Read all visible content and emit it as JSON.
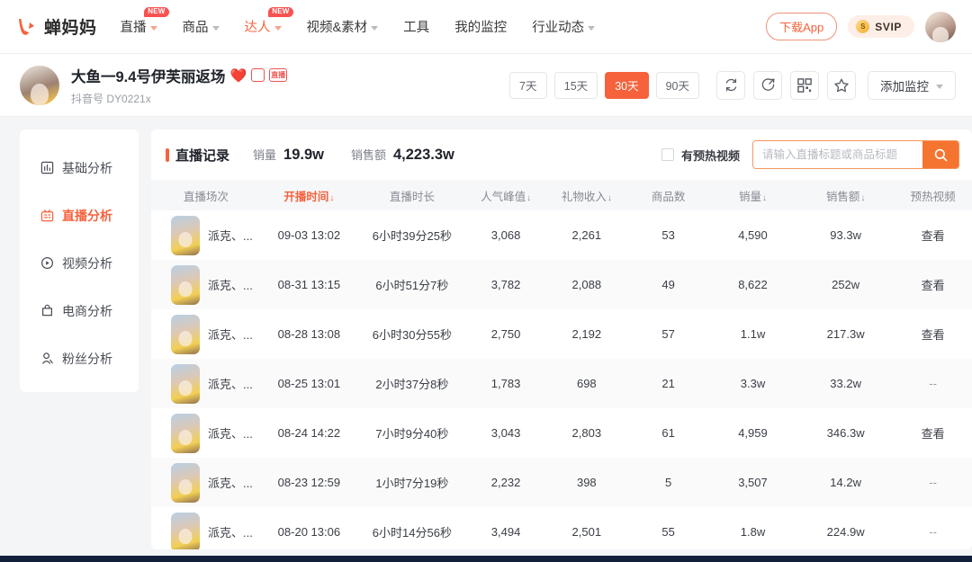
{
  "topbar": {
    "logo_text": "蝉妈妈",
    "nav": [
      {
        "label": "直播",
        "badge": "NEW",
        "caret": true,
        "active": false
      },
      {
        "label": "商品",
        "badge": "",
        "caret": true,
        "active": false
      },
      {
        "label": "达人",
        "badge": "NEW",
        "caret": true,
        "active": true
      },
      {
        "label": "视频&素材",
        "badge": "",
        "caret": true,
        "active": false
      },
      {
        "label": "工具",
        "badge": "",
        "caret": false,
        "active": false
      },
      {
        "label": "我的监控",
        "badge": "",
        "caret": false,
        "active": false
      },
      {
        "label": "行业动态",
        "badge": "",
        "caret": true,
        "active": false
      }
    ],
    "download_label": "下载App",
    "svip_label": "SVIP",
    "svip_gem": "S"
  },
  "profile": {
    "title": "大鱼一9.4号伊芙丽返场",
    "heart": "❤️",
    "sub_prefix": "抖音号",
    "sub_id": "DY0221x",
    "badge2_text": "直播",
    "ranges": [
      {
        "label": "7天",
        "active": false
      },
      {
        "label": "15天",
        "active": false
      },
      {
        "label": "30天",
        "active": true
      },
      {
        "label": "90天",
        "active": false
      }
    ],
    "icons": [
      "refresh-icon",
      "share-icon",
      "qrcode-icon",
      "star-icon"
    ],
    "monitor_label": "添加监控"
  },
  "sidebar": {
    "items": [
      {
        "label": "基础分析",
        "icon": "bar-chart-icon",
        "active": false
      },
      {
        "label": "直播分析",
        "icon": "live-icon",
        "active": true
      },
      {
        "label": "视频分析",
        "icon": "play-circle-icon",
        "active": false
      },
      {
        "label": "电商分析",
        "icon": "shopping-bag-icon",
        "active": false
      },
      {
        "label": "粉丝分析",
        "icon": "user-icon",
        "active": false
      }
    ]
  },
  "content": {
    "record_label": "直播记录",
    "stats": [
      {
        "key": "销量",
        "value": "19.9w"
      },
      {
        "key": "销售额",
        "value": "4,223.3w"
      }
    ],
    "checkbox_label": "有预热视频",
    "checkbox_checked": false,
    "search_placeholder": "请输入直播标题或商品标题",
    "search_value": "",
    "columns": [
      {
        "label": "直播场次",
        "sorted": false,
        "sort": ""
      },
      {
        "label": "开播时间",
        "sorted": true,
        "sort": "↓"
      },
      {
        "label": "直播时长",
        "sorted": false,
        "sort": ""
      },
      {
        "label": "人气峰值",
        "sorted": false,
        "sort": "↓"
      },
      {
        "label": "礼物收入",
        "sorted": false,
        "sort": "↓"
      },
      {
        "label": "商品数",
        "sorted": false,
        "sort": ""
      },
      {
        "label": "销量",
        "sorted": false,
        "sort": "↓"
      },
      {
        "label": "销售额",
        "sorted": false,
        "sort": "↓"
      },
      {
        "label": "预热视频",
        "sorted": false,
        "sort": ""
      }
    ],
    "rows": [
      {
        "session": "派克、...",
        "start": "09-03 13:02",
        "duration": "6小时39分25秒",
        "peak": "3,068",
        "gift": "2,261",
        "goods": "53",
        "volume": "4,590",
        "amount": "93.3w",
        "preheat": "查看"
      },
      {
        "session": "派克、...",
        "start": "08-31 13:15",
        "duration": "6小时51分7秒",
        "peak": "3,782",
        "gift": "2,088",
        "goods": "49",
        "volume": "8,622",
        "amount": "252w",
        "preheat": "查看"
      },
      {
        "session": "派克、...",
        "start": "08-28 13:08",
        "duration": "6小时30分55秒",
        "peak": "2,750",
        "gift": "2,192",
        "goods": "57",
        "volume": "1.1w",
        "amount": "217.3w",
        "preheat": "查看"
      },
      {
        "session": "派克、...",
        "start": "08-25 13:01",
        "duration": "2小时37分8秒",
        "peak": "1,783",
        "gift": "698",
        "goods": "21",
        "volume": "3.3w",
        "amount": "33.2w",
        "preheat": "--"
      },
      {
        "session": "派克、...",
        "start": "08-24 14:22",
        "duration": "7小时9分40秒",
        "peak": "3,043",
        "gift": "2,803",
        "goods": "61",
        "volume": "4,959",
        "amount": "346.3w",
        "preheat": "查看"
      },
      {
        "session": "派克、...",
        "start": "08-23 12:59",
        "duration": "1小时7分19秒",
        "peak": "2,232",
        "gift": "398",
        "goods": "5",
        "volume": "3,507",
        "amount": "14.2w",
        "preheat": "--"
      },
      {
        "session": "派克、...",
        "start": "08-20 13:06",
        "duration": "6小时14分56秒",
        "peak": "3,494",
        "gift": "2,501",
        "goods": "55",
        "volume": "1.8w",
        "amount": "224.9w",
        "preheat": "--"
      }
    ]
  },
  "colors": {
    "accent": "#f5623c",
    "accent_search": "#f5742f",
    "badge_red": "#fa5151",
    "page_bg": "#f4f5f7"
  }
}
